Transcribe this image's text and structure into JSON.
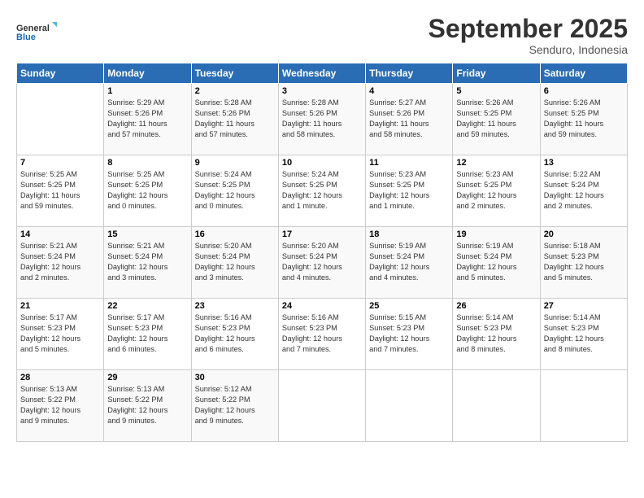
{
  "logo": {
    "line1": "General",
    "line2": "Blue"
  },
  "title": "September 2025",
  "subtitle": "Senduro, Indonesia",
  "days_header": [
    "Sunday",
    "Monday",
    "Tuesday",
    "Wednesday",
    "Thursday",
    "Friday",
    "Saturday"
  ],
  "weeks": [
    [
      {
        "day": "",
        "info": ""
      },
      {
        "day": "1",
        "info": "Sunrise: 5:29 AM\nSunset: 5:26 PM\nDaylight: 11 hours\nand 57 minutes."
      },
      {
        "day": "2",
        "info": "Sunrise: 5:28 AM\nSunset: 5:26 PM\nDaylight: 11 hours\nand 57 minutes."
      },
      {
        "day": "3",
        "info": "Sunrise: 5:28 AM\nSunset: 5:26 PM\nDaylight: 11 hours\nand 58 minutes."
      },
      {
        "day": "4",
        "info": "Sunrise: 5:27 AM\nSunset: 5:26 PM\nDaylight: 11 hours\nand 58 minutes."
      },
      {
        "day": "5",
        "info": "Sunrise: 5:26 AM\nSunset: 5:25 PM\nDaylight: 11 hours\nand 59 minutes."
      },
      {
        "day": "6",
        "info": "Sunrise: 5:26 AM\nSunset: 5:25 PM\nDaylight: 11 hours\nand 59 minutes."
      }
    ],
    [
      {
        "day": "7",
        "info": "Sunrise: 5:25 AM\nSunset: 5:25 PM\nDaylight: 11 hours\nand 59 minutes."
      },
      {
        "day": "8",
        "info": "Sunrise: 5:25 AM\nSunset: 5:25 PM\nDaylight: 12 hours\nand 0 minutes."
      },
      {
        "day": "9",
        "info": "Sunrise: 5:24 AM\nSunset: 5:25 PM\nDaylight: 12 hours\nand 0 minutes."
      },
      {
        "day": "10",
        "info": "Sunrise: 5:24 AM\nSunset: 5:25 PM\nDaylight: 12 hours\nand 1 minute."
      },
      {
        "day": "11",
        "info": "Sunrise: 5:23 AM\nSunset: 5:25 PM\nDaylight: 12 hours\nand 1 minute."
      },
      {
        "day": "12",
        "info": "Sunrise: 5:23 AM\nSunset: 5:25 PM\nDaylight: 12 hours\nand 2 minutes."
      },
      {
        "day": "13",
        "info": "Sunrise: 5:22 AM\nSunset: 5:24 PM\nDaylight: 12 hours\nand 2 minutes."
      }
    ],
    [
      {
        "day": "14",
        "info": "Sunrise: 5:21 AM\nSunset: 5:24 PM\nDaylight: 12 hours\nand 2 minutes."
      },
      {
        "day": "15",
        "info": "Sunrise: 5:21 AM\nSunset: 5:24 PM\nDaylight: 12 hours\nand 3 minutes."
      },
      {
        "day": "16",
        "info": "Sunrise: 5:20 AM\nSunset: 5:24 PM\nDaylight: 12 hours\nand 3 minutes."
      },
      {
        "day": "17",
        "info": "Sunrise: 5:20 AM\nSunset: 5:24 PM\nDaylight: 12 hours\nand 4 minutes."
      },
      {
        "day": "18",
        "info": "Sunrise: 5:19 AM\nSunset: 5:24 PM\nDaylight: 12 hours\nand 4 minutes."
      },
      {
        "day": "19",
        "info": "Sunrise: 5:19 AM\nSunset: 5:24 PM\nDaylight: 12 hours\nand 5 minutes."
      },
      {
        "day": "20",
        "info": "Sunrise: 5:18 AM\nSunset: 5:23 PM\nDaylight: 12 hours\nand 5 minutes."
      }
    ],
    [
      {
        "day": "21",
        "info": "Sunrise: 5:17 AM\nSunset: 5:23 PM\nDaylight: 12 hours\nand 5 minutes."
      },
      {
        "day": "22",
        "info": "Sunrise: 5:17 AM\nSunset: 5:23 PM\nDaylight: 12 hours\nand 6 minutes."
      },
      {
        "day": "23",
        "info": "Sunrise: 5:16 AM\nSunset: 5:23 PM\nDaylight: 12 hours\nand 6 minutes."
      },
      {
        "day": "24",
        "info": "Sunrise: 5:16 AM\nSunset: 5:23 PM\nDaylight: 12 hours\nand 7 minutes."
      },
      {
        "day": "25",
        "info": "Sunrise: 5:15 AM\nSunset: 5:23 PM\nDaylight: 12 hours\nand 7 minutes."
      },
      {
        "day": "26",
        "info": "Sunrise: 5:14 AM\nSunset: 5:23 PM\nDaylight: 12 hours\nand 8 minutes."
      },
      {
        "day": "27",
        "info": "Sunrise: 5:14 AM\nSunset: 5:23 PM\nDaylight: 12 hours\nand 8 minutes."
      }
    ],
    [
      {
        "day": "28",
        "info": "Sunrise: 5:13 AM\nSunset: 5:22 PM\nDaylight: 12 hours\nand 9 minutes."
      },
      {
        "day": "29",
        "info": "Sunrise: 5:13 AM\nSunset: 5:22 PM\nDaylight: 12 hours\nand 9 minutes."
      },
      {
        "day": "30",
        "info": "Sunrise: 5:12 AM\nSunset: 5:22 PM\nDaylight: 12 hours\nand 9 minutes."
      },
      {
        "day": "",
        "info": ""
      },
      {
        "day": "",
        "info": ""
      },
      {
        "day": "",
        "info": ""
      },
      {
        "day": "",
        "info": ""
      }
    ]
  ]
}
